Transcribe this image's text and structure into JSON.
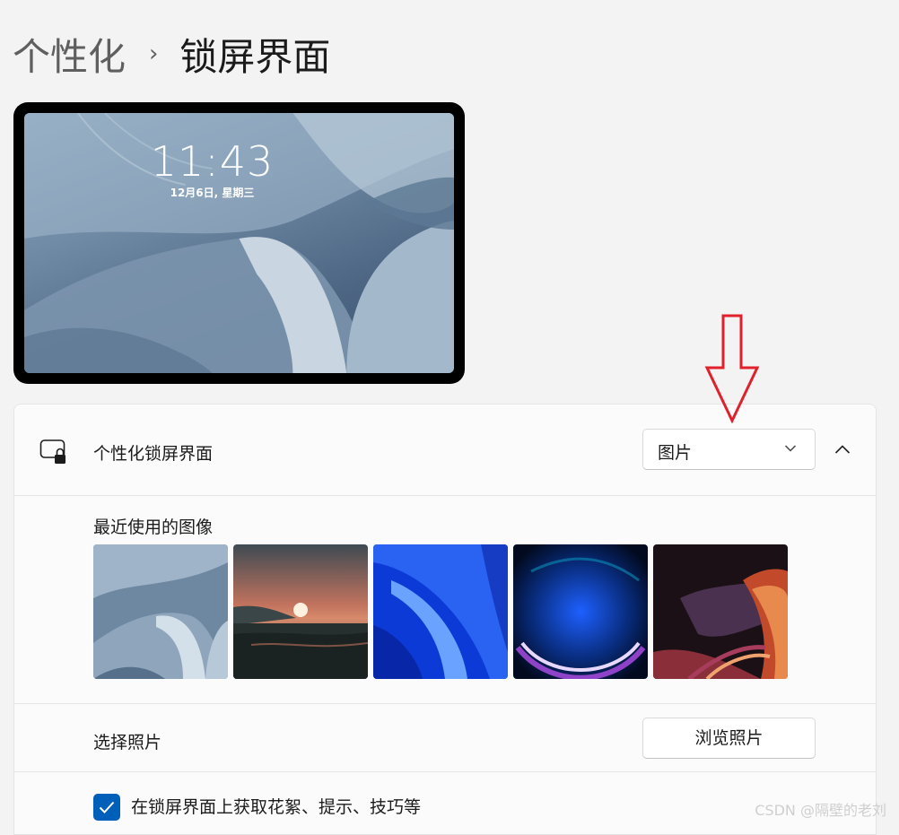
{
  "breadcrumb": {
    "parent": "个性化",
    "separator": "›",
    "current": "锁屏界面"
  },
  "preview": {
    "time": "11:43",
    "date": "12月6日, 星期三"
  },
  "lock_screen": {
    "title": "个性化锁屏界面",
    "select_value": "图片"
  },
  "recent_images": {
    "title": "最近使用的图像",
    "thumbnails": [
      "windows-bloom-light",
      "sunset-lake",
      "windows-bloom-blue",
      "windows-glow-dark",
      "abstract-ribbons"
    ]
  },
  "choose_photo": {
    "label": "选择照片",
    "button": "浏览照片"
  },
  "tips": {
    "label": "在锁屏界面上获取花絮、提示、技巧等",
    "checked": true
  },
  "watermark": "CSDN @隔壁的老刘",
  "colors": {
    "accent": "#005fb8",
    "annotation_arrow": "#e0202a"
  }
}
